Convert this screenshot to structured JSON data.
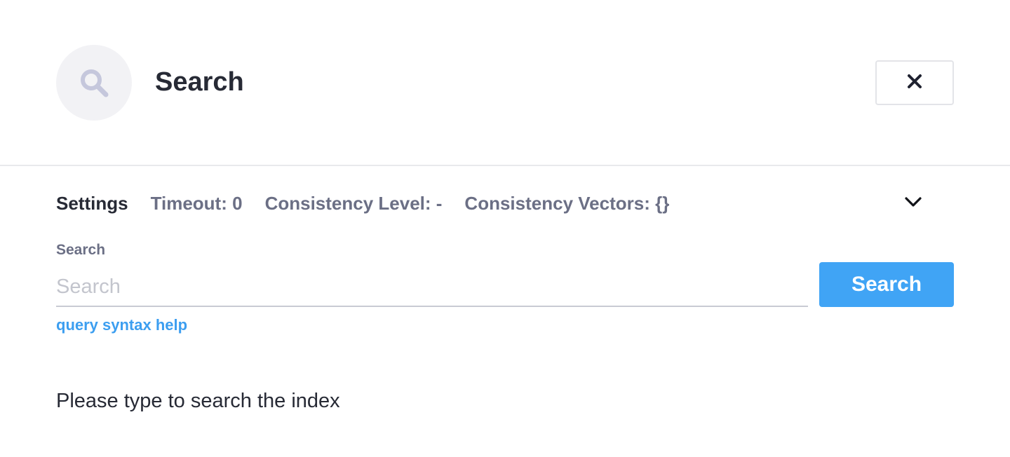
{
  "header": {
    "icon": "search-icon",
    "title": "Search",
    "close_icon": "close-icon"
  },
  "settings": {
    "label": "Settings",
    "timeout": "Timeout: 0",
    "consistency_level": "Consistency Level: -",
    "consistency_vectors": "Consistency Vectors: {}",
    "toggle_icon": "chevron-down-icon"
  },
  "search": {
    "label": "Search",
    "placeholder": "Search",
    "value": "",
    "button_label": "Search",
    "help_link": "query syntax help"
  },
  "results": {
    "empty_message": "Please type to search the index"
  },
  "colors": {
    "accent": "#40a4f5",
    "link": "#3c9ef0",
    "muted_text": "#6b6f85",
    "icon_bg": "#f2f2f5",
    "icon_fg": "#c5c7dc"
  }
}
